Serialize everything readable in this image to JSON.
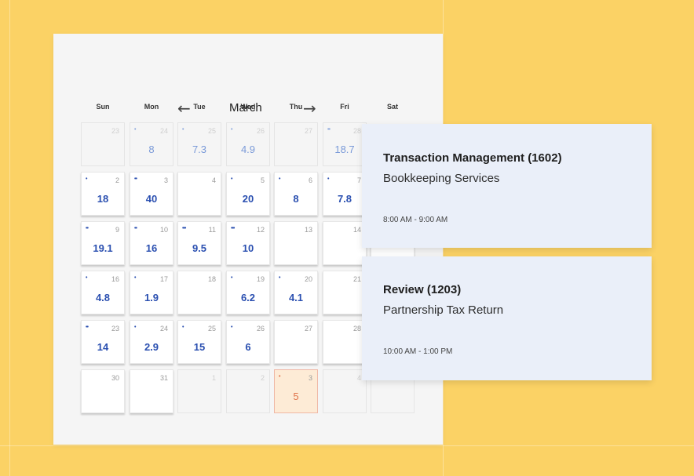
{
  "calendar": {
    "month": "March",
    "prev_icon": "arrow-left-icon",
    "next_icon": "arrow-right-icon",
    "weekdays": [
      "Sun",
      "Mon",
      "Tue",
      "Wed",
      "Thu",
      "Fri",
      "Sat"
    ],
    "weeks": [
      [
        {
          "day": "23",
          "value": "",
          "dots": "",
          "state": "faded"
        },
        {
          "day": "24",
          "value": "8",
          "dots": "•",
          "state": "faded"
        },
        {
          "day": "25",
          "value": "7.3",
          "dots": "•",
          "state": "faded"
        },
        {
          "day": "26",
          "value": "4.9",
          "dots": "•",
          "state": "faded"
        },
        {
          "day": "27",
          "value": "",
          "dots": "",
          "state": "faded"
        },
        {
          "day": "28",
          "value": "18.7",
          "dots": "••",
          "state": "faded"
        },
        {
          "day": "",
          "value": "",
          "dots": "",
          "state": "hidden"
        }
      ],
      [
        {
          "day": "2",
          "value": "18",
          "dots": "•",
          "state": "filled"
        },
        {
          "day": "3",
          "value": "40",
          "dots": "••",
          "state": "filled"
        },
        {
          "day": "4",
          "value": "",
          "dots": "",
          "state": "filled"
        },
        {
          "day": "5",
          "value": "20",
          "dots": "•",
          "state": "filled"
        },
        {
          "day": "6",
          "value": "8",
          "dots": "•",
          "state": "filled"
        },
        {
          "day": "7",
          "value": "7.8",
          "dots": "•",
          "state": "filled"
        },
        {
          "day": "",
          "value": "",
          "dots": "",
          "state": "hidden"
        }
      ],
      [
        {
          "day": "9",
          "value": "19.1",
          "dots": "••",
          "state": "filled"
        },
        {
          "day": "10",
          "value": "16",
          "dots": "••",
          "state": "filled"
        },
        {
          "day": "11",
          "value": "9.5",
          "dots": "•••",
          "state": "filled"
        },
        {
          "day": "12",
          "value": "10",
          "dots": "•••",
          "state": "filled"
        },
        {
          "day": "13",
          "value": "",
          "dots": "",
          "state": "filled"
        },
        {
          "day": "14",
          "value": "",
          "dots": "",
          "state": "filled"
        },
        {
          "day": "",
          "value": "",
          "dots": "",
          "state": "filled"
        }
      ],
      [
        {
          "day": "16",
          "value": "4.8",
          "dots": "•",
          "state": "filled"
        },
        {
          "day": "17",
          "value": "1.9",
          "dots": "•",
          "state": "filled"
        },
        {
          "day": "18",
          "value": "",
          "dots": "",
          "state": "filled"
        },
        {
          "day": "19",
          "value": "6.2",
          "dots": "•",
          "state": "filled"
        },
        {
          "day": "20",
          "value": "4.1",
          "dots": "•",
          "state": "filled"
        },
        {
          "day": "21",
          "value": "",
          "dots": "",
          "state": "filled"
        },
        {
          "day": "",
          "value": "",
          "dots": "",
          "state": "hidden"
        }
      ],
      [
        {
          "day": "23",
          "value": "14",
          "dots": "••",
          "state": "filled"
        },
        {
          "day": "24",
          "value": "2.9",
          "dots": "•",
          "state": "filled"
        },
        {
          "day": "25",
          "value": "15",
          "dots": "•",
          "state": "filled"
        },
        {
          "day": "26",
          "value": "6",
          "dots": "•",
          "state": "filled"
        },
        {
          "day": "27",
          "value": "",
          "dots": "",
          "state": "filled"
        },
        {
          "day": "28",
          "value": "",
          "dots": "",
          "state": "filled"
        },
        {
          "day": "",
          "value": "",
          "dots": "",
          "state": "hidden"
        }
      ],
      [
        {
          "day": "30",
          "value": "",
          "dots": "",
          "state": "filled"
        },
        {
          "day": "31",
          "value": "",
          "dots": "",
          "state": "filled"
        },
        {
          "day": "1",
          "value": "",
          "dots": "",
          "state": "faded"
        },
        {
          "day": "2",
          "value": "",
          "dots": "",
          "state": "faded"
        },
        {
          "day": "3",
          "value": "5",
          "dots": "•",
          "state": "today"
        },
        {
          "day": "4",
          "value": "",
          "dots": "",
          "state": "faded"
        },
        {
          "day": "",
          "value": "",
          "dots": "",
          "state": "faded"
        }
      ]
    ]
  },
  "events": [
    {
      "title": "Transaction Management (1602)",
      "subtitle": "Bookkeeping Services",
      "time": "8:00 AM - 9:00 AM"
    },
    {
      "title": "Review (1203)",
      "subtitle": "Partnership Tax Return",
      "time": "10:00 AM - 1:00 PM"
    }
  ],
  "colors": {
    "background": "#fbd265",
    "accent": "#2a4fb0",
    "today": "#e0734a",
    "card": "#eaeff9"
  }
}
